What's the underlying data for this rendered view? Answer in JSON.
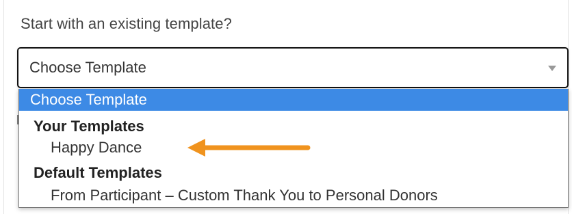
{
  "form": {
    "question": "Start with an existing template?",
    "select_value": "Choose Template"
  },
  "dropdown": {
    "selected_option": "Choose Template",
    "groups": [
      {
        "label": "Your Templates",
        "items": [
          "Happy Dance"
        ]
      },
      {
        "label": "Default Templates",
        "items": [
          "From Participant – Custom Thank You to Personal Donors"
        ]
      }
    ]
  },
  "colors": {
    "selected_bg": "#3d8ae5",
    "arrow": "#f0931e"
  },
  "annotation": {
    "icon": "arrow-left-icon"
  }
}
